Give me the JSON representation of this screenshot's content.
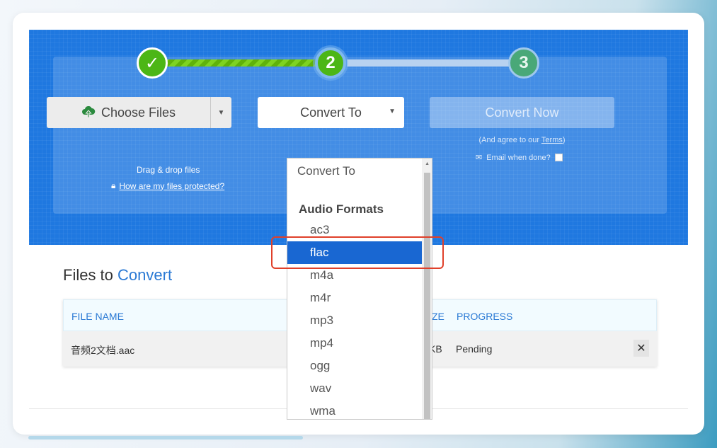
{
  "stepper": {
    "step1": "✓",
    "step2": "2",
    "step3": "3"
  },
  "upload": {
    "choose_label": "Choose Files",
    "drag_text": "Drag & drop files",
    "protect_link": "How are my files protected?"
  },
  "convert_select": {
    "label": "Convert To"
  },
  "convert_now": {
    "label": "Convert Now",
    "agree_prefix": "(And agree to our ",
    "agree_link": "Terms",
    "agree_suffix": ")",
    "email_label": "Email when done?"
  },
  "files": {
    "title_prefix": "Files to ",
    "title_accent": "Convert",
    "columns": [
      "FILE NAME",
      "ZE",
      "PROGRESS"
    ],
    "row": {
      "file_name": "音频2文档.aac",
      "size_fragment": "KB",
      "progress": "Pending",
      "remove": "✕"
    }
  },
  "dropdown": {
    "placeholder": "Convert To",
    "group_label": "Audio Formats",
    "options": [
      "ac3",
      "flac",
      "m4a",
      "m4r",
      "mp3",
      "mp4",
      "ogg",
      "wav",
      "wma"
    ],
    "selected": "flac"
  },
  "colors": {
    "hero_blue": "#1f78e0",
    "accent_blue": "#2a79d4",
    "step_green": "#4cb616",
    "selected_bg": "#1967d2",
    "highlight_red": "#e0402a"
  }
}
